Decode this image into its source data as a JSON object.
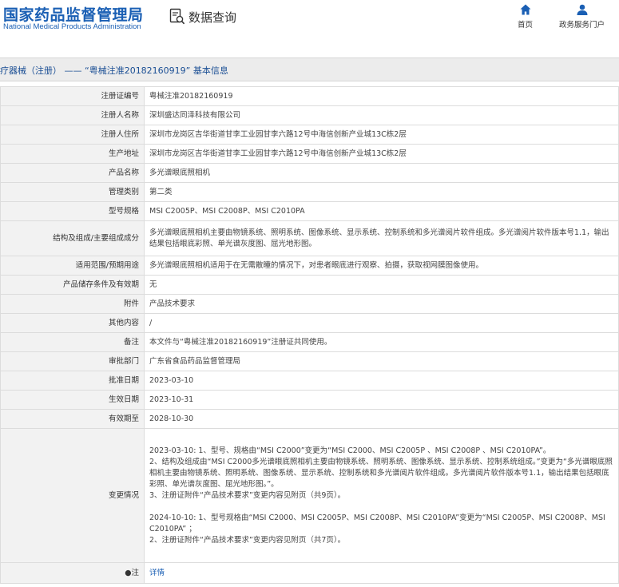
{
  "header": {
    "logo_cn": "国家药品监督管理局",
    "logo_en": "National Medical Products Administration",
    "query_label": "数据查询",
    "query_icon": "search-document-icon",
    "nav": [
      {
        "label": "首页",
        "icon": "home-icon"
      },
      {
        "label": "政务服务门户",
        "icon": "user-icon"
      }
    ]
  },
  "title": "疗器械（注册） —— “粤械注准20182160919” 基本信息",
  "rows": [
    {
      "label": "注册证编号",
      "value": "粤械注准20182160919"
    },
    {
      "label": "注册人名称",
      "value": "深圳盛达同泽科技有限公司"
    },
    {
      "label": "注册人住所",
      "value": "深圳市龙岗区吉华街道甘李工业园甘李六路12号中海信创新产业城13C栋2层"
    },
    {
      "label": "生产地址",
      "value": "深圳市龙岗区吉华街道甘李工业园甘李六路12号中海信创新产业城13C栋2层"
    },
    {
      "label": "产品名称",
      "value": "多光谱眼底照相机"
    },
    {
      "label": "管理类别",
      "value": "第二类"
    },
    {
      "label": "型号规格",
      "value": "MSI C2005P、MSI C2008P、MSI C2010PA"
    },
    {
      "label": "结构及组成/主要组成成分",
      "value": "多光谱眼底照相机主要由物镜系统、照明系统、图像系统、显示系统、控制系统和多光谱阅片软件组成。多光谱阅片软件版本号1.1，输出结果包括眼底彩照、单光谱灰度图、屈光地形图。"
    },
    {
      "label": "适用范围/预期用途",
      "value": "多光谱眼底照相机适用于在无需散瞳的情况下，对患者眼底进行观察、拍摄，获取视网膜图像使用。"
    },
    {
      "label": "产品储存条件及有效期",
      "value": "无"
    },
    {
      "label": "附件",
      "value": "产品技术要求"
    },
    {
      "label": "其他内容",
      "value": "/"
    },
    {
      "label": "备注",
      "value": "本文件与“粤械注准20182160919”注册证共同使用。"
    },
    {
      "label": "审批部门",
      "value": "广东省食品药品监督管理局"
    },
    {
      "label": "批准日期",
      "value": "2023-03-10"
    },
    {
      "label": "生效日期",
      "value": "2023-10-31"
    },
    {
      "label": "有效期至",
      "value": "2028-10-30"
    },
    {
      "label": "变更情况",
      "value": "2023-03-10: 1、型号、规格由“MSI C2000”变更为“MSI C2000、MSI C2005P 、MSI C2008P 、MSI C2010PA”。\n2、结构及组成由“MSI C2000多光谱眼底照相机主要由物镜系统、照明系统、图像系统、显示系统、控制系统组成。”变更为“多光谱眼底照相机主要由物镜系统、照明系统、图像系统、显示系统、控制系统和多光谱阅片软件组成。多光谱阅片软件版本号1.1，输出结果包括眼底彩照、单光谱灰度图、屈光地形图。”。\n3、注册证附件“产品技术要求”变更内容见附页（共9页）。\n\n2024-10-10: 1、型号规格由“MSI C2000、MSI C2005P、MSI C2008P、MSI C2010PA”变更为“MSI C2005P、MSI C2008P、MSI C2010PA” ；\n2、注册证附件“产品技术要求”变更内容见附页（共7页）。"
    },
    {
      "label": "●注",
      "value": "详情"
    }
  ]
}
